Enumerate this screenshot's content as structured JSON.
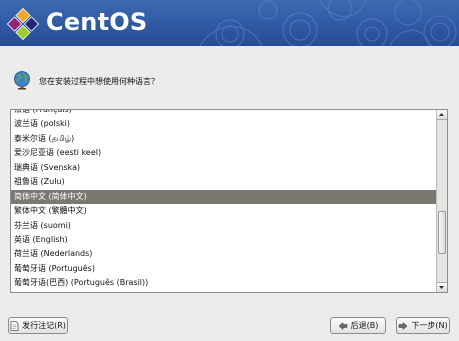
{
  "header": {
    "brand": "CentOS"
  },
  "prompt": {
    "text": "您在安装过程中想使用何种语言？"
  },
  "languages": {
    "items": [
      {
        "label": "法语 (Français)",
        "selected": false
      },
      {
        "label": "波兰语 (polski)",
        "selected": false
      },
      {
        "label": "泰米尔语 (தமிழ்)",
        "selected": false
      },
      {
        "label": "爱沙尼亚语 (eesti keel)",
        "selected": false
      },
      {
        "label": "瑞典语 (Svenska)",
        "selected": false
      },
      {
        "label": "祖鲁语 (Zulu)",
        "selected": false
      },
      {
        "label": "简体中文 (简体中文)",
        "selected": true
      },
      {
        "label": "繁体中文 (繁體中文)",
        "selected": false
      },
      {
        "label": "芬兰语 (suomi)",
        "selected": false
      },
      {
        "label": "英语 (English)",
        "selected": false
      },
      {
        "label": "荷兰语 (Nederlands)",
        "selected": false
      },
      {
        "label": "葡萄牙语 (Português)",
        "selected": false
      },
      {
        "label": "葡萄牙语(巴西) (Português (Brasil))",
        "selected": false
      }
    ]
  },
  "buttons": {
    "release_notes": "发行注记(R)",
    "back": "后退(B)",
    "next": "下一步(N)"
  },
  "colors": {
    "banner": "#2f5aa3",
    "selection": "#7a7870"
  },
  "icons": {
    "logo": "centos-logo-icon",
    "prompt": "globe-icon",
    "release_notes": "document-icon",
    "back": "arrow-left-icon",
    "next": "arrow-right-icon"
  }
}
